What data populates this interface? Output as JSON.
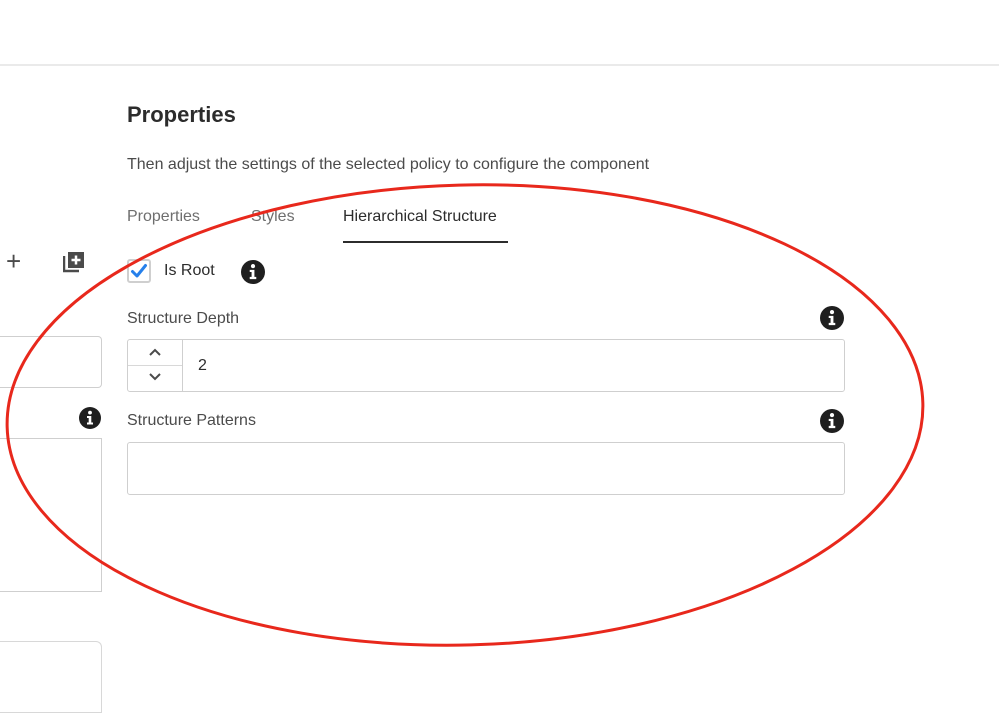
{
  "panel": {
    "title": "Properties",
    "subtitle": "Then adjust the settings of the selected policy to configure the component"
  },
  "tabs": [
    {
      "label": "Properties",
      "active": false
    },
    {
      "label": "Styles",
      "active": false
    },
    {
      "label": "Hierarchical Structure",
      "active": true
    }
  ],
  "is_root": {
    "label": "Is Root",
    "checked": true
  },
  "structure_depth": {
    "label": "Structure Depth",
    "value": "2"
  },
  "structure_patterns": {
    "label": "Structure Patterns",
    "value": ""
  },
  "left_panel": {
    "add_icon": "plus-icon",
    "copy_icon": "copy-icon",
    "info_icon": "info-icon"
  },
  "colors": {
    "annotation": "#e8281c",
    "checkmark": "#2680eb",
    "text": "#2c2c2c"
  }
}
